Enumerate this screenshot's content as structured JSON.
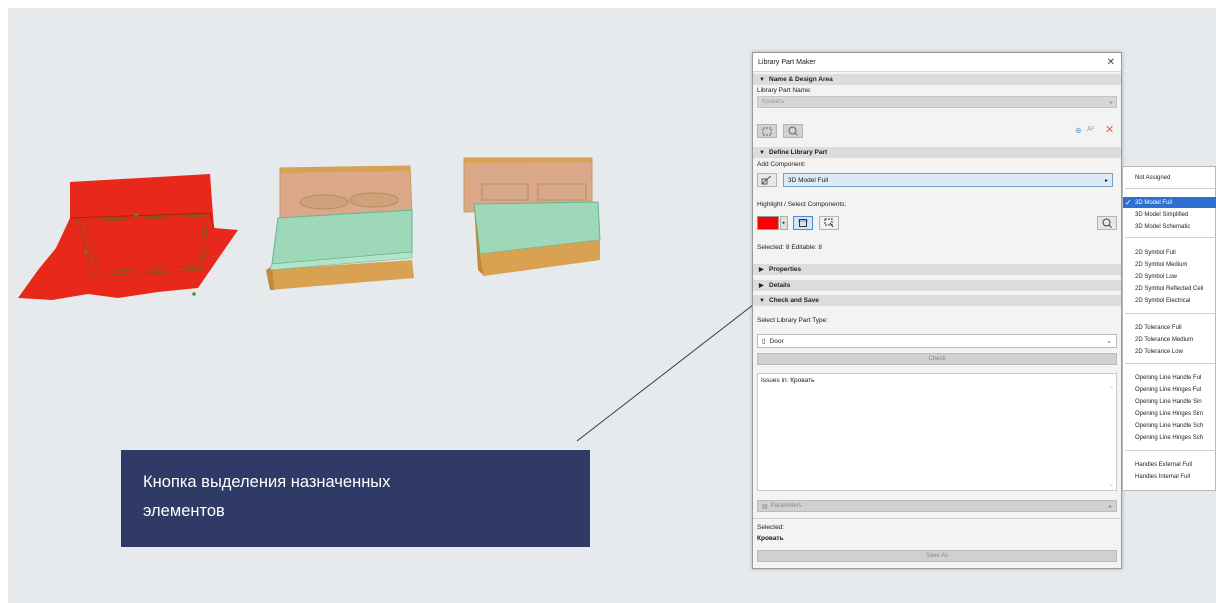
{
  "dialog": {
    "title": "Library Part Maker",
    "close": "✕",
    "sections": {
      "name_design": "Name & Design Area",
      "define": "Define Library Part",
      "properties": "Properties",
      "details": "Details",
      "check_save": "Check and Save"
    },
    "library_part_name_label": "Library Part Name:",
    "library_part_name_value": "Кровать",
    "add_component_label": "Add Component:",
    "component_value": "3D Model Full",
    "highlight_label": "Highlight / Select Components:",
    "selected_editable": "Selected: 8 Editable: 8",
    "select_type_label": "Select Library Part Type:",
    "type_value": "Door",
    "check_button": "Check",
    "issues_text": "Issues in: Кровать",
    "parameters_button": "Parameters",
    "selected_label": "Selected:",
    "selected_value": "Кровать",
    "save_as_button": "Save As",
    "highlight_color": "#ff0000"
  },
  "dropdown": {
    "items": [
      "Not Assigned",
      "3D Model Full",
      "3D Model Simplified",
      "3D Model Schematic",
      "2D Symbol Full",
      "2D Symbol Medium",
      "2D Symbol Low",
      "2D Symbol Reflected Ceil",
      "2D Symbol Electrical",
      "2D Tolerance Full",
      "2D Tolerance Medium",
      "2D Tolerance Low",
      "Opening Line Handle Ful",
      "Opening Line Hinges Ful",
      "Opening Line Handle Sin",
      "Opening Line Hinges Sim",
      "Opening Line Handle Sch",
      "Opening Line Hinges Sch",
      "Handles External Full",
      "Handles Internal Full"
    ],
    "selected": "3D Model Full",
    "selected_color": "#2f6fd1"
  },
  "callout": {
    "line1": "Кнопка выделения назначенных",
    "line2": "элементов",
    "background": "#2f3a66"
  },
  "scene": {
    "bed_red_color": "#e8281a",
    "mattress_color": "#9fd8b8",
    "wood_color": "#d9a253",
    "headboard_color": "#dba88a"
  }
}
